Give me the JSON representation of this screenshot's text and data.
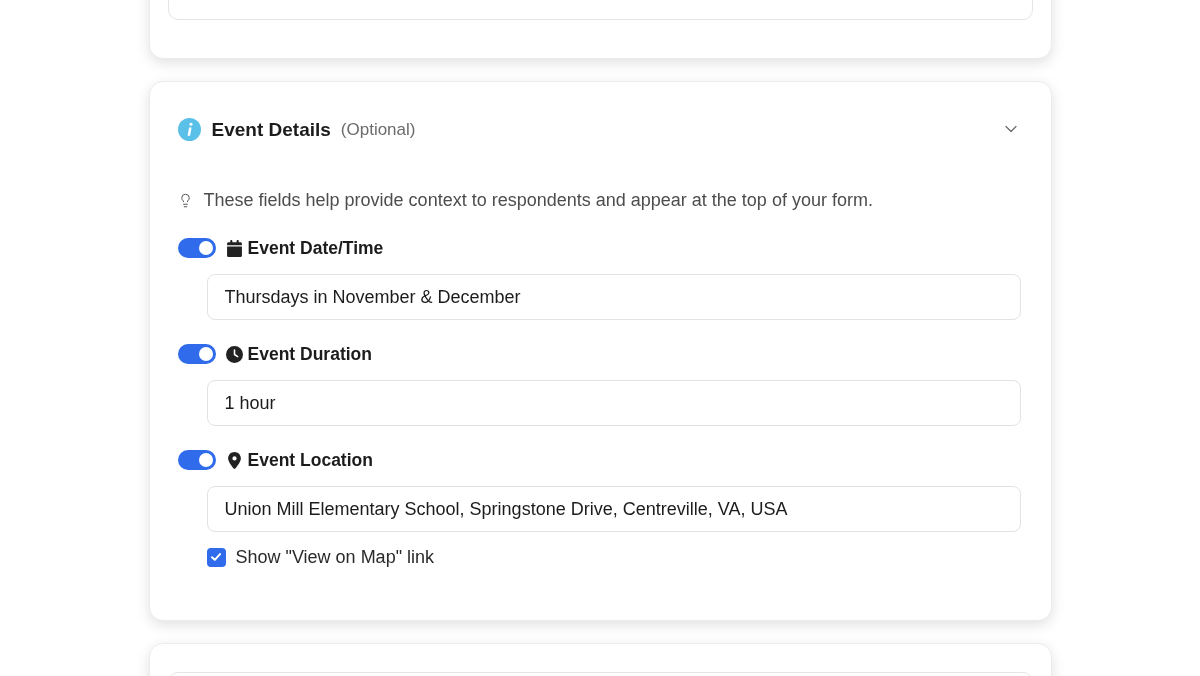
{
  "section": {
    "title": "Event Details",
    "note": "(Optional)",
    "hint": "These fields help provide context to respondents and appear at the top of your form."
  },
  "fields": [
    {
      "kind": "date",
      "label": "Event Date/Time",
      "on": true,
      "value": "Thursdays in November & December"
    },
    {
      "kind": "duration",
      "label": "Event Duration",
      "on": true,
      "value": "1 hour"
    },
    {
      "kind": "location",
      "label": "Event Location",
      "on": true,
      "value": "Union Mill Elementary School, Springstone Drive, Centreville, VA, USA",
      "option": {
        "label": "Show \"View on Map\" link",
        "checked": true
      }
    }
  ]
}
